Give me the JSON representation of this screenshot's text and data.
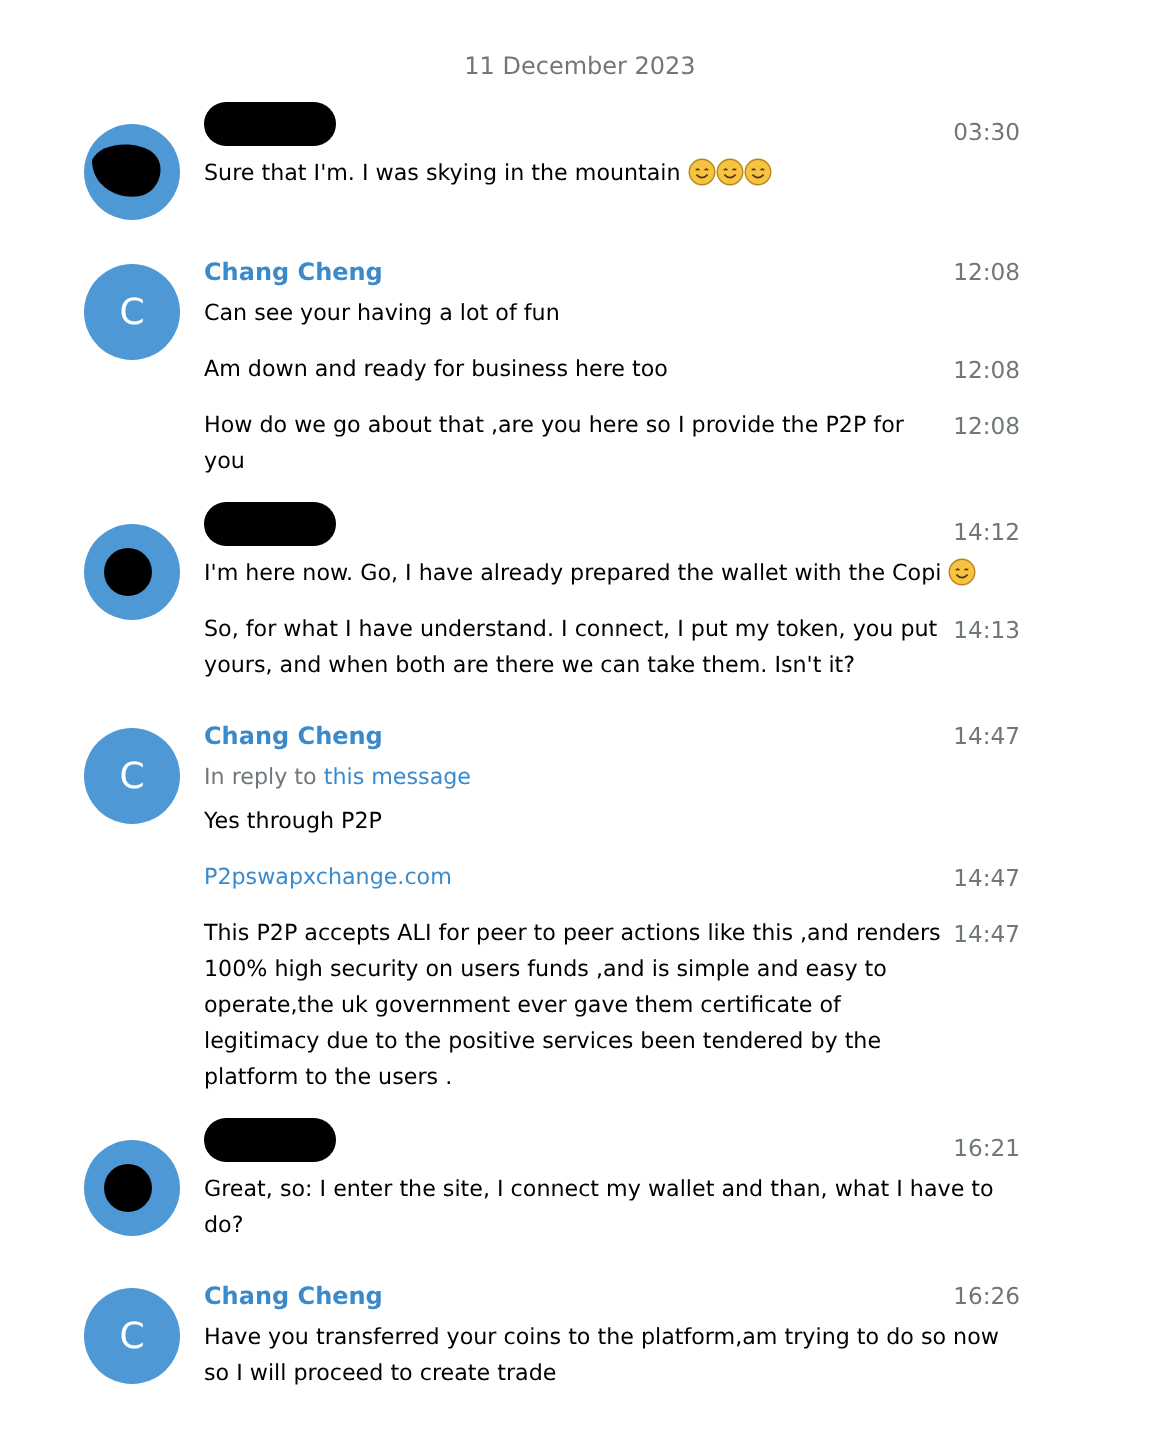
{
  "date": "11 December 2023",
  "groups": [
    {
      "avatar": {
        "kind": "redacted-blob"
      },
      "sender": {
        "kind": "redacted"
      },
      "time": "03:30",
      "messages": [
        {
          "kind": "text",
          "text": "Sure that I'm. I was skying in the mountain",
          "emojis": [
            {
              "kind": "smile"
            },
            {
              "kind": "smile"
            },
            {
              "kind": "smile"
            }
          ]
        }
      ]
    },
    {
      "avatar": {
        "kind": "letter",
        "letter": "C"
      },
      "sender": {
        "kind": "name",
        "name": "Chang Cheng"
      },
      "time": "12:08",
      "messages": [
        {
          "kind": "text",
          "text": "Can see your having a lot of fun"
        },
        {
          "kind": "text",
          "text": "Am down and ready for business here too",
          "time": "12:08"
        },
        {
          "kind": "text",
          "text": "How do we go about that ,are you here so I provide the P2P for you",
          "time": "12:08"
        }
      ]
    },
    {
      "avatar": {
        "kind": "redacted-dot"
      },
      "sender": {
        "kind": "redacted"
      },
      "time": "14:12",
      "messages": [
        {
          "kind": "text",
          "text": "I'm here now. Go, I have already prepared the wallet with the Copi",
          "emojis": [
            {
              "kind": "smile"
            }
          ]
        },
        {
          "kind": "text",
          "text": "So, for what I have understand. I connect, I put my token, you put yours, and when both are there we can take them. Isn't it?",
          "time": "14:13"
        }
      ]
    },
    {
      "avatar": {
        "kind": "letter",
        "letter": "C"
      },
      "sender": {
        "kind": "name",
        "name": "Chang Cheng"
      },
      "time": "14:47",
      "reply": {
        "prefix": "In reply to",
        "link": "this message"
      },
      "messages": [
        {
          "kind": "text",
          "text": "Yes through P2P"
        },
        {
          "kind": "link",
          "text": "P2pswapxchange.com",
          "time": "14:47"
        },
        {
          "kind": "text",
          "text": "This P2P accepts ALI for peer to peer actions like this ,and renders 100% high security on users funds ,and is simple and easy to operate,the uk government ever gave them certificate of legitimacy due to the positive services been tendered by the platform to the users .",
          "time": "14:47"
        }
      ]
    },
    {
      "avatar": {
        "kind": "redacted-dot"
      },
      "sender": {
        "kind": "redacted"
      },
      "time": "16:21",
      "messages": [
        {
          "kind": "text",
          "text": "Great, so: I enter the site, I connect my wallet and than, what I have to do?"
        }
      ]
    },
    {
      "avatar": {
        "kind": "letter",
        "letter": "C"
      },
      "sender": {
        "kind": "name",
        "name": "Chang Cheng"
      },
      "time": "16:26",
      "messages": [
        {
          "kind": "text",
          "text": "Have you transferred your coins to the platform,am trying to do so now so I will proceed to create trade"
        }
      ]
    }
  ]
}
